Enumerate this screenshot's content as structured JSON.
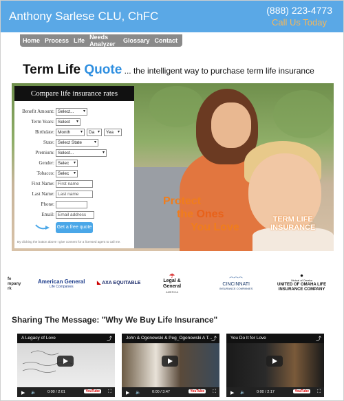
{
  "header": {
    "brand": "Anthony Sarlese CLU, ChFC",
    "phone": "(888) 223-4773",
    "call_today": "Call Us Today"
  },
  "nav": {
    "items": [
      "Home",
      "Process",
      "Life",
      "Needs Analyzer",
      "Glossary",
      "Contact"
    ]
  },
  "headline": {
    "main_a": "Term Life ",
    "main_b": "Quote",
    "sub": " ... the intelligent way to purchase term life insurance"
  },
  "form": {
    "title": "Compare life insurance rates",
    "fields": {
      "benefit_amount": {
        "label": "Benefit Amount:",
        "value": "Select..."
      },
      "term_years": {
        "label": "Term Years:",
        "value": "Select"
      },
      "birthdate": {
        "label": "Birthdate:",
        "month": "Month",
        "day": "Da",
        "year": "Yea"
      },
      "state": {
        "label": "State:",
        "value": "Select State"
      },
      "premium": {
        "label": "Premium:",
        "value": "Select..."
      },
      "gender": {
        "label": "Gender:",
        "value": "Selec"
      },
      "tobacco": {
        "label": "Tobacco:",
        "value": "Selec"
      },
      "first_name": {
        "label": "First Name:",
        "placeholder": "First name"
      },
      "last_name": {
        "label": "Last Name:",
        "placeholder": "Last name"
      },
      "phone": {
        "label": "Phone:",
        "placeholder": ""
      },
      "email": {
        "label": "Email:",
        "placeholder": "Email address"
      }
    },
    "submit": "Get a free quote",
    "consent": "By clicking the button above I give consent for a licensed agent to call me."
  },
  "hero": {
    "protect_line1": "Protect",
    "protect_line2a": "the ",
    "protect_line2b": "Ones",
    "protect_line3": "You Love",
    "badge_line1": "TERM LIFE",
    "badge_line2": "INSURANCE"
  },
  "logos": {
    "partial": "fe\nmpany\nrk",
    "american_general": "American General",
    "american_general_sub": "Life Companies",
    "axa": "AXA EQUITABLE",
    "legal_general_a": "Legal &",
    "legal_general_b": "General",
    "legal_general_sub": "AMERICA",
    "cincinnati": "CINCINNATI",
    "cincinnati_sub": "INSURANCE COMPANIES",
    "omaha_top": "Mutual of Omaha",
    "omaha_a": "UNITED OF OMAHA LIFE",
    "omaha_b": "INSURANCE COMPANY"
  },
  "sharing": {
    "heading": "Sharing The Message: \"Why We Buy Life Insurance\""
  },
  "videos": [
    {
      "title": "A Legacy of Love",
      "time": "0:00 / 2:01"
    },
    {
      "title": "John & Ogonowski & Peg_Ogonowski A T...",
      "time": "0:00 / 3:47"
    },
    {
      "title": "You Do It for Love",
      "time": "0:00 / 2:17"
    }
  ],
  "video_ui": {
    "youtube": "YouTube"
  },
  "colors": {
    "header_bg": "#5aa8e6",
    "accent_orange": "#f5b75a",
    "quote_blue": "#2f8fe0",
    "button_blue": "#4aa7e8",
    "protect_orange": "#f07d1c"
  }
}
